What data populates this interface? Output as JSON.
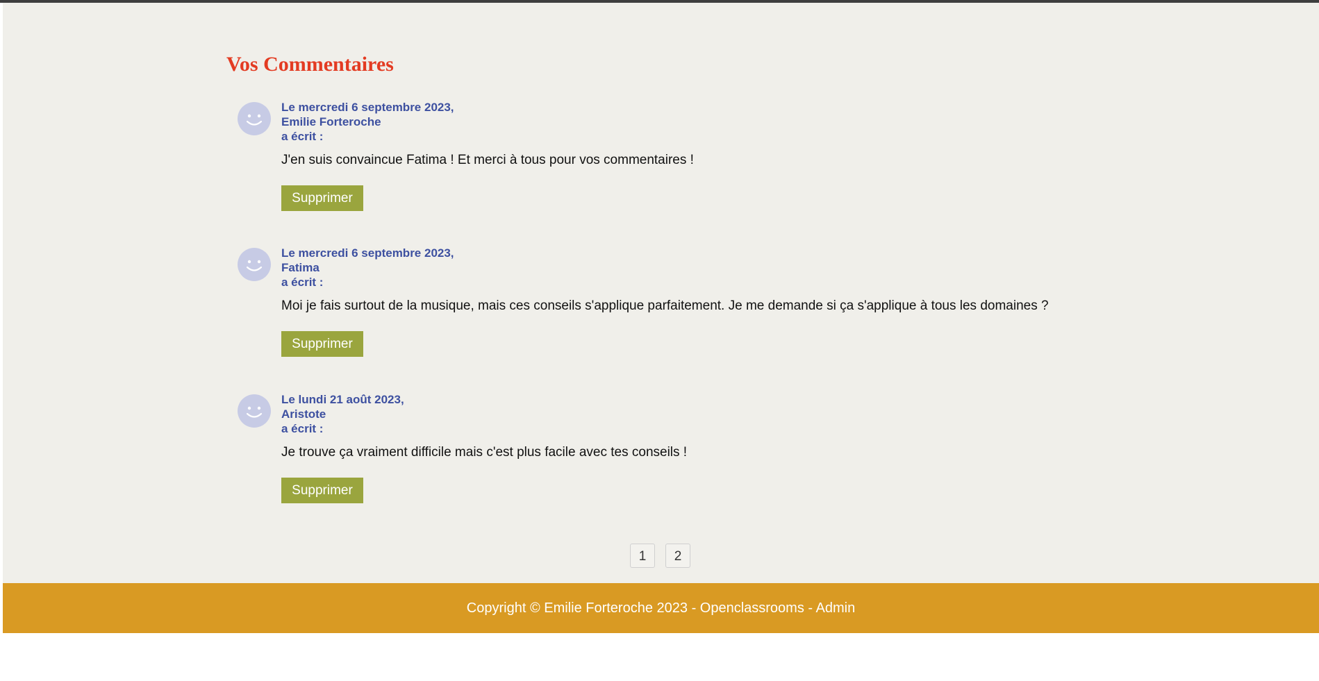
{
  "section": {
    "title": "Vos Commentaires"
  },
  "comments": [
    {
      "date": "Le mercredi 6 septembre 2023,",
      "author": "Emilie Forteroche",
      "wrote": "a écrit :",
      "text": "J'en suis convaincue Fatima ! Et merci à tous pour vos commentaires !",
      "delete_label": "Supprimer"
    },
    {
      "date": "Le mercredi 6 septembre 2023,",
      "author": "Fatima",
      "wrote": "a écrit :",
      "text": "Moi je fais surtout de la musique, mais ces conseils s'applique parfaitement. Je me demande si ça s'applique à tous les domaines ?",
      "delete_label": "Supprimer"
    },
    {
      "date": "Le lundi 21 août 2023,",
      "author": "Aristote",
      "wrote": "a écrit :",
      "text": "Je trouve ça vraiment difficile mais c'est plus facile avec tes conseils !",
      "delete_label": "Supprimer"
    }
  ],
  "pagination": {
    "pages": [
      "1",
      "2"
    ]
  },
  "footer": {
    "text": "Copyright © Emilie Forteroche 2023 - Openclassrooms - Admin"
  },
  "colors": {
    "title": "#e33b22",
    "meta": "#3d50a0",
    "button": "#9aa53e",
    "footer": "#d99a23",
    "background": "#f0efea",
    "avatar": "#c7cbe5"
  },
  "icons": {
    "avatar": "smiley-face-icon"
  }
}
